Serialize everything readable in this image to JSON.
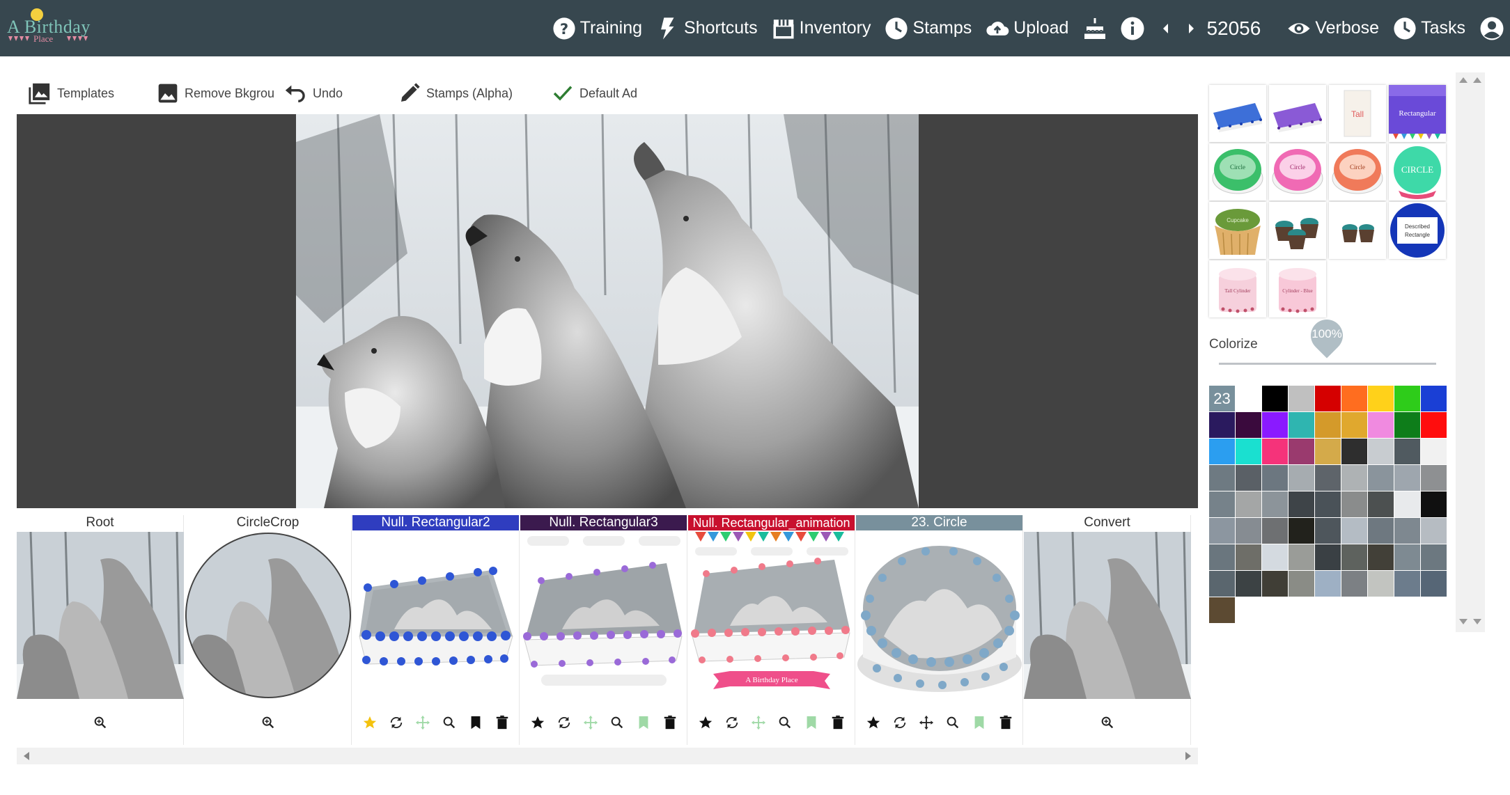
{
  "brand": {
    "line1": "A Birthday",
    "line2": "Place",
    "colors": {
      "text": "#7fc4b8",
      "accent": "#e28ca3",
      "sun": "#f4d03f"
    }
  },
  "nav": {
    "training": "Training",
    "shortcuts": "Shortcuts",
    "inventory": "Inventory",
    "stamps": "Stamps",
    "upload": "Upload",
    "count": "52056",
    "verbose": "Verbose",
    "tasks": "Tasks"
  },
  "toolbar": {
    "templates": "Templates",
    "remove_bg": "Remove Bkgrou",
    "undo": "Undo",
    "stamps": "Stamps (Alpha)",
    "default_ad": "Default Ad"
  },
  "cards": [
    {
      "title": "Root",
      "kind": "photo",
      "actions": [
        "zoom-icon"
      ]
    },
    {
      "title": "CircleCrop",
      "kind": "circle",
      "actions": [
        "zoom-icon"
      ]
    },
    {
      "title": "Null. Rectangular2",
      "kind": "rect-blue",
      "header_color": "#2f3dbf",
      "actions": [
        "star-icon",
        "refresh-icon",
        "move-icon",
        "zoom-icon",
        "bookmark-icon",
        "trash-icon"
      ]
    },
    {
      "title": "Null. Rectangular3",
      "kind": "rect-purple",
      "header_color": "#3b1a4e",
      "actions": [
        "star-icon",
        "refresh-icon",
        "move-icon",
        "zoom-icon",
        "bookmark-icon",
        "trash-icon"
      ]
    },
    {
      "title": "Null. Rectangular_animation",
      "kind": "rect-pink",
      "header_color": "#c8102e",
      "actions": [
        "star-icon",
        "refresh-icon",
        "move-icon",
        "zoom-icon",
        "bookmark-icon",
        "trash-icon"
      ]
    },
    {
      "title": "23. Circle",
      "kind": "round-cake",
      "header_color": "#78909c",
      "actions": [
        "star-icon",
        "refresh-icon",
        "move-icon",
        "zoom-icon",
        "bookmark-icon",
        "trash-icon"
      ]
    },
    {
      "title": "Convert",
      "kind": "photo",
      "actions": [
        "zoom-icon"
      ]
    }
  ],
  "cake_banner": "A Birthday Place",
  "templates_panel": {
    "tall_label": "Tall",
    "rect_label": "Rectangular",
    "circle_labels": [
      "Circle",
      "Circle",
      "Circle",
      "CIRCLE"
    ],
    "described_line1": "Described",
    "described_line2": "Rectangle",
    "cupcake_label": "Cupcake",
    "cylinder_labels": [
      "Tall Cylinder",
      "Cylinder - Blue"
    ]
  },
  "colorize": {
    "label": "Colorize",
    "value": "100%",
    "level": 0.5
  },
  "palette": {
    "count": "23",
    "colors": [
      "#ffffff",
      "#000000",
      "#c0c0c0",
      "#d50000",
      "#ff6d1f",
      "#ffd11a",
      "#2ecc1a",
      "#1a3fd5",
      "#2a1a5e",
      "#3a0a3d",
      "#8a1aff",
      "#2fb5b0",
      "#d49a2a",
      "#e0a82e",
      "#f08ae0",
      "#0e7d1a",
      "#ff0d0d",
      "#2b9ef0",
      "#1ae0d0",
      "#f5337a",
      "#9a3a6e",
      "#d4aa4a",
      "#2e2e2e",
      "#c8ccd0",
      "#505a60",
      "#f1f1f1",
      "#6e7a82",
      "#5a6066",
      "#6c7780",
      "#a6acb0",
      "#5e646a",
      "#aeb2b4",
      "#8a949c",
      "#9ea6ae",
      "#8e9092",
      "#76828a",
      "#a4a6a6",
      "#8c949a",
      "#3e4448",
      "#4a5258",
      "#8a8c8c",
      "#4c5050",
      "#e8eaec",
      "#101010",
      "#8c96a0",
      "#868c92",
      "#6e7072",
      "#22221c",
      "#4e565c",
      "#b4bcc4",
      "#6e7880",
      "#7e8890",
      "#b6bcc2",
      "#6a767e",
      "#6e6e68",
      "#d4dae0",
      "#9a9c98",
      "#3a4044",
      "#5e625e",
      "#424038",
      "#7e8a92",
      "#6c7880",
      "#5a666e",
      "#3c4244",
      "#403e36",
      "#8a8c86",
      "#9eb0c4",
      "#7c8084",
      "#c2c4c0",
      "#6c7c8c",
      "#566676",
      "#5c4a32"
    ]
  }
}
